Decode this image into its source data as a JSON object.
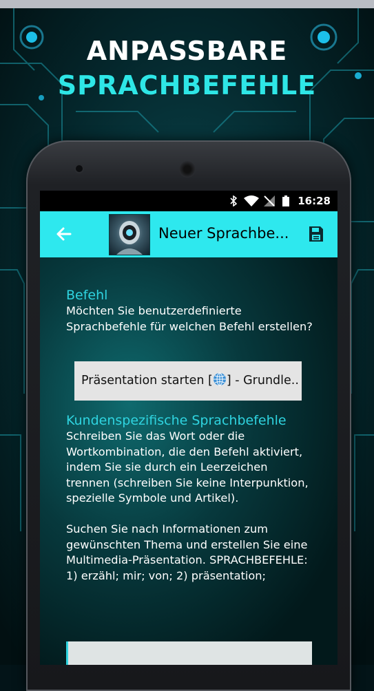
{
  "promo": {
    "line1": "ANPASSBARE",
    "line2": "SPRACHBEFEHLE"
  },
  "status_bar": {
    "time": "16:28",
    "icons": [
      "bluetooth-icon",
      "wifi-icon",
      "no-signal-icon",
      "battery-icon"
    ]
  },
  "app_bar": {
    "title": "Neuer Sprachbe...",
    "back_icon": "arrow-left-icon",
    "save_icon": "floppy-disk-icon"
  },
  "command_section": {
    "heading": "Befehl",
    "description": "Möchten Sie benutzerdefinierte Sprachbefehle für welchen Befehl erstellen?",
    "selected_command_prefix": "Präsentation starten [",
    "selected_command_suffix": "] - Grundle.."
  },
  "custom_section": {
    "heading": "Kundenspezifische Sprachbefehle",
    "instructions": "Schreiben Sie das Wort oder die Wortkombination, die den Befehl aktiviert, indem Sie sie durch ein Leerzeichen trennen (schreiben Sie keine Interpunktion, spezielle Symbole und Artikel).",
    "details": "Suchen Sie nach Informationen zum gewünschten Thema und erstellen Sie eine Multimedia-Präsentation. SPRACHBEFEHLE: 1) erzähl; mir; von; 2) präsentation;"
  },
  "colors": {
    "accent": "#2ee8ee",
    "heading": "#2fd4e0",
    "background": "#031418"
  }
}
